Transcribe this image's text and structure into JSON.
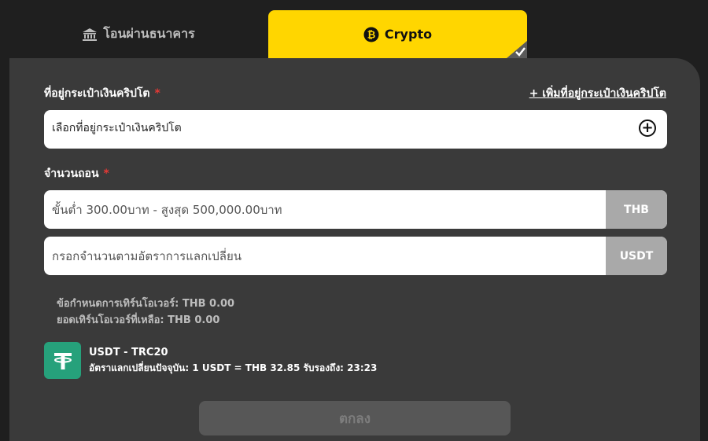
{
  "tabs": {
    "bank_label": "โอนผ่านธนาคาร",
    "crypto_label": "Crypto",
    "active": "crypto",
    "accent": "#ffd600"
  },
  "wallet": {
    "label": "ที่อยู่กระเป๋าเงินคริปโต",
    "required_mark": "*",
    "add_link": "+ เพิ่มที่อยู่กระเป๋าเงินคริปโต",
    "select_value": "เลือกที่อยู่กระเป๋าเงินคริปโต"
  },
  "amount": {
    "label": "จำนวนถอน",
    "required_mark": "*",
    "thb_placeholder": "ขั้นต่ำ 300.00บาท - สูงสุด 500,000.00บาท",
    "thb_unit": "THB",
    "usdt_placeholder": "กรอกจำนวนตามอัตราการแลกเปลี่ยน",
    "usdt_unit": "USDT"
  },
  "turnover": {
    "requirement": "ข้อกำหนดการเทิร์นโอเวอร์: THB 0.00",
    "remaining": "ยอดเทิร์นโอเวอร์ที่เหลือ: THB 0.00"
  },
  "currency": {
    "icon": "tether-icon",
    "name": "USDT - TRC20",
    "rate": "อัตราแลกเปลี่ยนปัจจุบัน: 1 USDT = THB 32.85 รับรองถึง: 23:23",
    "color": "#26a17b"
  },
  "submit": {
    "label": "ตกลง"
  }
}
